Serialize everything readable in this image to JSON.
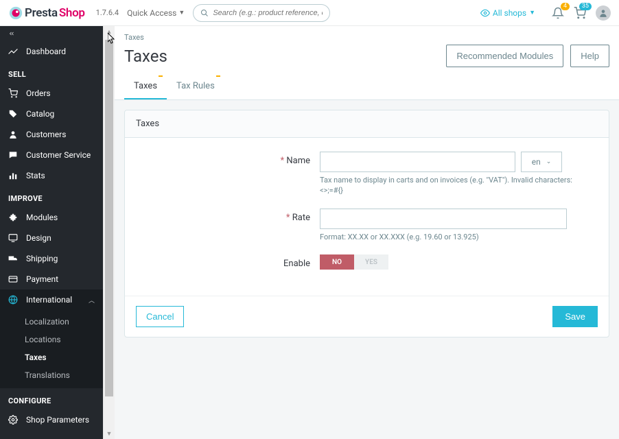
{
  "brand": {
    "name1": "Presta",
    "name2": "Shop",
    "version": "1.7.6.4"
  },
  "topbar": {
    "quick_access": "Quick Access",
    "search_placeholder": "Search (e.g.: product reference, customer)",
    "all_shops": "All shops",
    "notif_count": "4",
    "cart_count": "35"
  },
  "sidebar": {
    "dashboard": "Dashboard",
    "sections": {
      "sell": "SELL",
      "improve": "IMPROVE",
      "configure": "CONFIGURE"
    },
    "sell_items": [
      "Orders",
      "Catalog",
      "Customers",
      "Customer Service",
      "Stats"
    ],
    "improve_items": [
      "Modules",
      "Design",
      "Shipping",
      "Payment",
      "International"
    ],
    "intl_sub": [
      "Localization",
      "Locations",
      "Taxes",
      "Translations"
    ],
    "configure_items": [
      "Shop Parameters"
    ]
  },
  "page": {
    "breadcrumb": "Taxes",
    "title": "Taxes",
    "btn_recommended": "Recommended Modules",
    "btn_help": "Help",
    "tabs": [
      "Taxes",
      "Tax Rules"
    ]
  },
  "form": {
    "panel_title": "Taxes",
    "name_label": "Name",
    "name_help": "Tax name to display in carts and on invoices (e.g. \"VAT\"). Invalid characters: <>;=#{}",
    "lang": "en",
    "rate_label": "Rate",
    "rate_help": "Format: XX.XX or XX.XXX (e.g. 19.60 or 13.925)",
    "enable_label": "Enable",
    "toggle_no": "NO",
    "toggle_yes": "YES",
    "cancel": "Cancel",
    "save": "Save"
  }
}
